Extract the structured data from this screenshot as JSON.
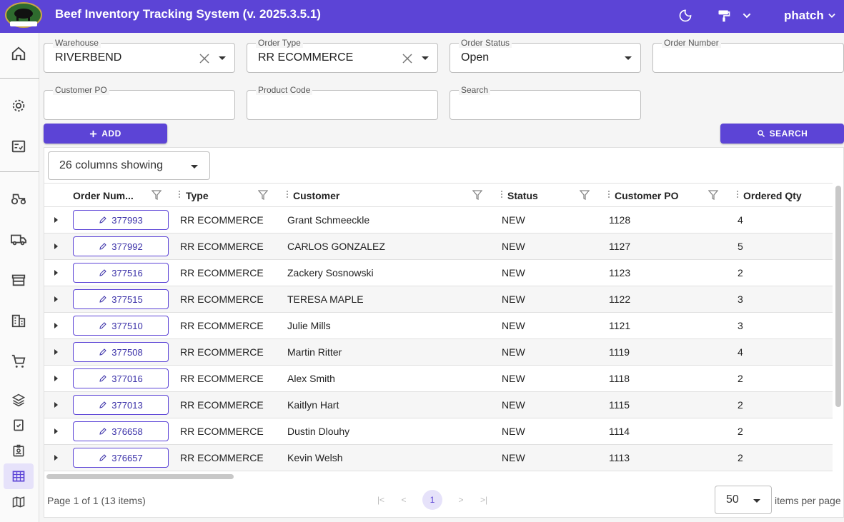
{
  "app": {
    "title": "Beef Inventory Tracking System (v. 2025.3.5.1)",
    "logo_text": "RIVERBEND",
    "user": "phatch",
    "brand_color": "#5c44d6"
  },
  "topbar_icons": [
    "moon-icon",
    "paint-roller-icon",
    "chevron-down-icon"
  ],
  "sidebar": {
    "items": [
      {
        "name": "home-icon"
      },
      {
        "name": "gear-icon"
      },
      {
        "name": "checklist-icon"
      },
      {
        "name": "tractor-icon"
      },
      {
        "name": "truck-icon"
      },
      {
        "name": "store-icon"
      },
      {
        "name": "building-icon"
      },
      {
        "name": "cart-icon"
      },
      {
        "name": "layers-icon"
      },
      {
        "name": "clipboard-check-icon"
      },
      {
        "name": "badge-icon"
      },
      {
        "name": "table-icon",
        "active": true
      },
      {
        "name": "map-icon"
      }
    ]
  },
  "filters": {
    "warehouse": {
      "label": "Warehouse",
      "value": "RIVERBEND"
    },
    "order_type": {
      "label": "Order Type",
      "value": "RR ECOMMERCE"
    },
    "order_status": {
      "label": "Order Status",
      "value": "Open"
    },
    "order_number": {
      "label": "Order Number",
      "value": ""
    },
    "customer_po": {
      "label": "Customer PO",
      "value": ""
    },
    "product_code": {
      "label": "Product Code",
      "value": ""
    },
    "search": {
      "label": "Search",
      "value": ""
    }
  },
  "buttons": {
    "add": "ADD",
    "search": "SEARCH"
  },
  "grid": {
    "columns_showing": "26 columns showing",
    "headers": {
      "order_number": "Order Num...",
      "type": "Type",
      "customer": "Customer",
      "status": "Status",
      "customer_po": "Customer PO",
      "ordered_qty": "Ordered Qty"
    },
    "rows": [
      {
        "order": "377993",
        "type": "RR ECOMMERCE",
        "customer": "Grant Schmeeckle",
        "status": "NEW",
        "po": "1128",
        "qty": "4"
      },
      {
        "order": "377992",
        "type": "RR ECOMMERCE",
        "customer": "CARLOS GONZALEZ",
        "status": "NEW",
        "po": "1127",
        "qty": "5"
      },
      {
        "order": "377516",
        "type": "RR ECOMMERCE",
        "customer": "Zackery Sosnowski",
        "status": "NEW",
        "po": "1123",
        "qty": "2"
      },
      {
        "order": "377515",
        "type": "RR ECOMMERCE",
        "customer": "TERESA MAPLE",
        "status": "NEW",
        "po": "1122",
        "qty": "3"
      },
      {
        "order": "377510",
        "type": "RR ECOMMERCE",
        "customer": "Julie Mills",
        "status": "NEW",
        "po": "1121",
        "qty": "3"
      },
      {
        "order": "377508",
        "type": "RR ECOMMERCE",
        "customer": "Martin Ritter",
        "status": "NEW",
        "po": "1119",
        "qty": "4"
      },
      {
        "order": "377016",
        "type": "RR ECOMMERCE",
        "customer": "Alex Smith",
        "status": "NEW",
        "po": "1118",
        "qty": "2"
      },
      {
        "order": "377013",
        "type": "RR ECOMMERCE",
        "customer": "Kaitlyn Hart",
        "status": "NEW",
        "po": "1115",
        "qty": "2"
      },
      {
        "order": "376658",
        "type": "RR ECOMMERCE",
        "customer": "Dustin Dlouhy",
        "status": "NEW",
        "po": "1114",
        "qty": "2"
      },
      {
        "order": "376657",
        "type": "RR ECOMMERCE",
        "customer": "Kevin Welsh",
        "status": "NEW",
        "po": "1113",
        "qty": "2"
      }
    ]
  },
  "pager": {
    "info": "Page 1 of 1 (13 items)",
    "current_page": "1",
    "per_page": "50",
    "per_page_label": "items per page"
  }
}
